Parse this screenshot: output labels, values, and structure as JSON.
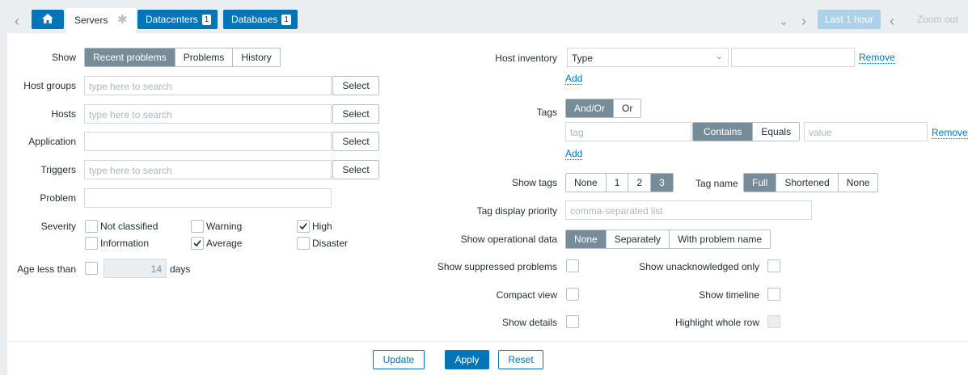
{
  "tabs": {
    "active": {
      "label": "Servers",
      "icon": "gear-icon"
    },
    "others": [
      {
        "label": "Datacenters",
        "count": "1"
      },
      {
        "label": "Databases",
        "count": "1"
      }
    ],
    "time_range": "Last 1 hour",
    "zoom_out": "Zoom out"
  },
  "filter": {
    "show": {
      "label": "Show",
      "options": [
        "Recent problems",
        "Problems",
        "History"
      ],
      "selected": "Recent problems"
    },
    "host_groups": {
      "label": "Host groups",
      "placeholder": "type here to search",
      "button": "Select"
    },
    "hosts": {
      "label": "Hosts",
      "placeholder": "type here to search",
      "button": "Select"
    },
    "application": {
      "label": "Application",
      "value": "",
      "button": "Select"
    },
    "triggers": {
      "label": "Triggers",
      "placeholder": "type here to search",
      "button": "Select"
    },
    "problem": {
      "label": "Problem",
      "value": ""
    },
    "severity": {
      "label": "Severity",
      "items": [
        {
          "label": "Not classified",
          "checked": false
        },
        {
          "label": "Information",
          "checked": false
        },
        {
          "label": "Warning",
          "checked": false
        },
        {
          "label": "Average",
          "checked": true
        },
        {
          "label": "High",
          "checked": true
        },
        {
          "label": "Disaster",
          "checked": false
        }
      ]
    },
    "age": {
      "label": "Age less than",
      "value": "14",
      "unit": "days",
      "checked": false
    },
    "host_inventory": {
      "label": "Host inventory",
      "field": "Type",
      "value": "",
      "remove": "Remove",
      "add": "Add"
    },
    "tags": {
      "label": "Tags",
      "operator": [
        "And/Or",
        "Or"
      ],
      "operator_selected": "And/Or",
      "tag_placeholder": "tag",
      "match": [
        "Contains",
        "Equals"
      ],
      "match_selected": "Contains",
      "value_placeholder": "value",
      "remove": "Remove",
      "add": "Add"
    },
    "show_tags": {
      "label": "Show tags",
      "options": [
        "None",
        "1",
        "2",
        "3"
      ],
      "selected": "3"
    },
    "tag_name": {
      "label": "Tag name",
      "options": [
        "Full",
        "Shortened",
        "None"
      ],
      "selected": "Full"
    },
    "tag_priority": {
      "label": "Tag display priority",
      "placeholder": "comma-separated list"
    },
    "operational_data": {
      "label": "Show operational data",
      "options": [
        "None",
        "Separately",
        "With problem name"
      ],
      "selected": "None"
    },
    "show_suppressed": {
      "label": "Show suppressed problems",
      "checked": false
    },
    "show_unack": {
      "label": "Show unacknowledged only",
      "checked": false
    },
    "compact_view": {
      "label": "Compact view",
      "checked": false
    },
    "show_timeline": {
      "label": "Show timeline",
      "checked": false
    },
    "show_details": {
      "label": "Show details",
      "checked": false
    },
    "highlight_row": {
      "label": "Highlight whole row",
      "checked": false,
      "disabled": true
    }
  },
  "actions": {
    "update": "Update",
    "apply": "Apply",
    "reset": "Reset"
  },
  "colors": {
    "accent": "#0275b8",
    "selected_segment": "#768d99",
    "background": "#ebeef0"
  }
}
